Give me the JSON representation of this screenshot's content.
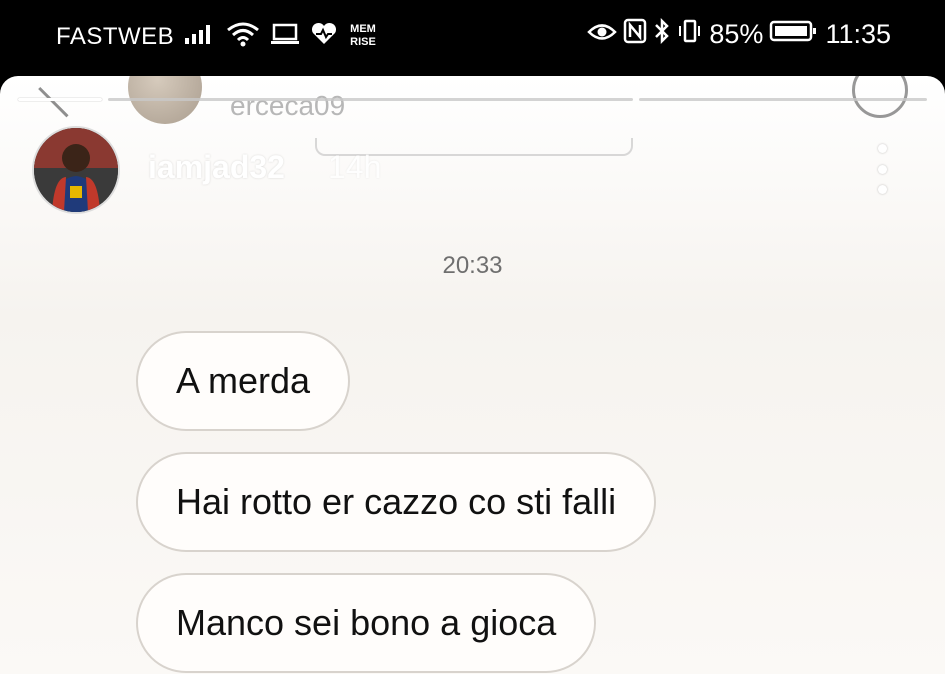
{
  "statusbar": {
    "carrier": "FASTWEB",
    "battery": "85%",
    "time": "11:35",
    "memrise_icon_text": "MEM RISE",
    "icons": [
      "signal-icon",
      "wifi-icon",
      "laptop-icon",
      "heart-icon",
      "memrise-icon",
      "eye-icon",
      "nfc-icon",
      "bluetooth-icon",
      "vibrate-icon",
      "battery-icon"
    ]
  },
  "story": {
    "underlay_username": "erceca09",
    "username": "iamjad32",
    "age": "14h",
    "timestamp": "20:33",
    "messages": [
      "A merda",
      "Hai rotto er cazzo co sti falli",
      "Manco sei bono a gioca"
    ]
  },
  "colors": {
    "statusbar_bg": "#000000",
    "bubble_border": "#d8d3cd",
    "bubble_bg": "#fffdfb",
    "timestamp_text": "#6f6f6f"
  }
}
